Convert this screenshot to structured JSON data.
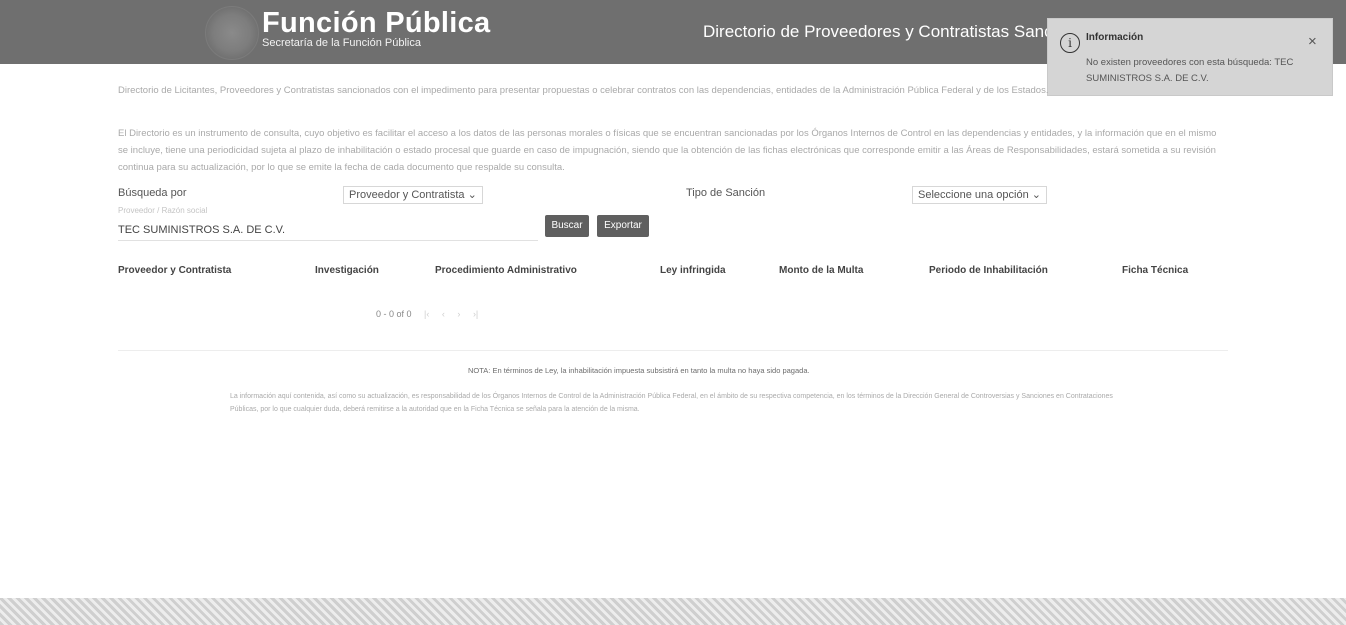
{
  "header": {
    "brand_title": "Función Pública",
    "brand_subtitle": "Secretaría de la Función Pública",
    "page_title": "Directorio de Proveedores y Contratistas Sancionados"
  },
  "toast": {
    "title": "Información",
    "message": "No existen proveedores con esta búsqueda: TEC SUMINISTROS S.A. DE C.V.",
    "close": "×",
    "icon": "info-icon"
  },
  "intro": {
    "p1": "Directorio de Licitantes, Proveedores y Contratistas sancionados con el impedimento para presentar propuestas o celebrar contratos con las dependencias, entidades de la Administración Pública Federal y de los Estados.",
    "p2": "El Directorio es un instrumento de consulta, cuyo objetivo es facilitar el acceso a los datos de las personas morales o físicas que se encuentran sancionadas por los Órganos Internos de Control en las dependencias y entidades, y la información que en el mismo se incluye, tiene una periodicidad sujeta al plazo de inhabilitación o estado procesal que guarde en caso de impugnación, siendo que la obtención de las fichas electrónicas que corresponde emitir a las Áreas de Responsabilidades, estará sometida a su revisión continua para su actualización, por lo que se emite la fecha de cada documento que respalde su consulta."
  },
  "filters": {
    "search_by_label": "Búsqueda por",
    "search_by_value": "Proveedor y Contratista",
    "sanction_type_label": "Tipo de Sanción",
    "sanction_type_value": "Seleccione una opción",
    "search_hint": "Proveedor / Razón social",
    "search_value": "TEC SUMINISTROS S.A. DE C.V.",
    "search_button": "Buscar",
    "export_button": "Exportar"
  },
  "table": {
    "columns": [
      "Proveedor y Contratista",
      "Investigación",
      "Procedimiento Administrativo",
      "Ley infringida",
      "Monto de la Multa",
      "Periodo de Inhabilitación",
      "Ficha Técnica"
    ],
    "pager_text": "0 - 0 of 0"
  },
  "footer": {
    "note": "NOTA: En términos de Ley, la inhabilitación impuesta subsistirá en tanto la multa no haya sido pagada.",
    "disclaimer": "La información aquí contenida, así como su actualización, es responsabilidad de los Órganos Internos de Control de la Administración Pública Federal, en el ámbito de su respectiva competencia, en los términos de la Dirección General de Controversias y Sanciones en Contrataciones Públicas, por lo que cualquier duda, deberá remitirse a la autoridad que en la Ficha Técnica se señala para la atención de la misma."
  }
}
